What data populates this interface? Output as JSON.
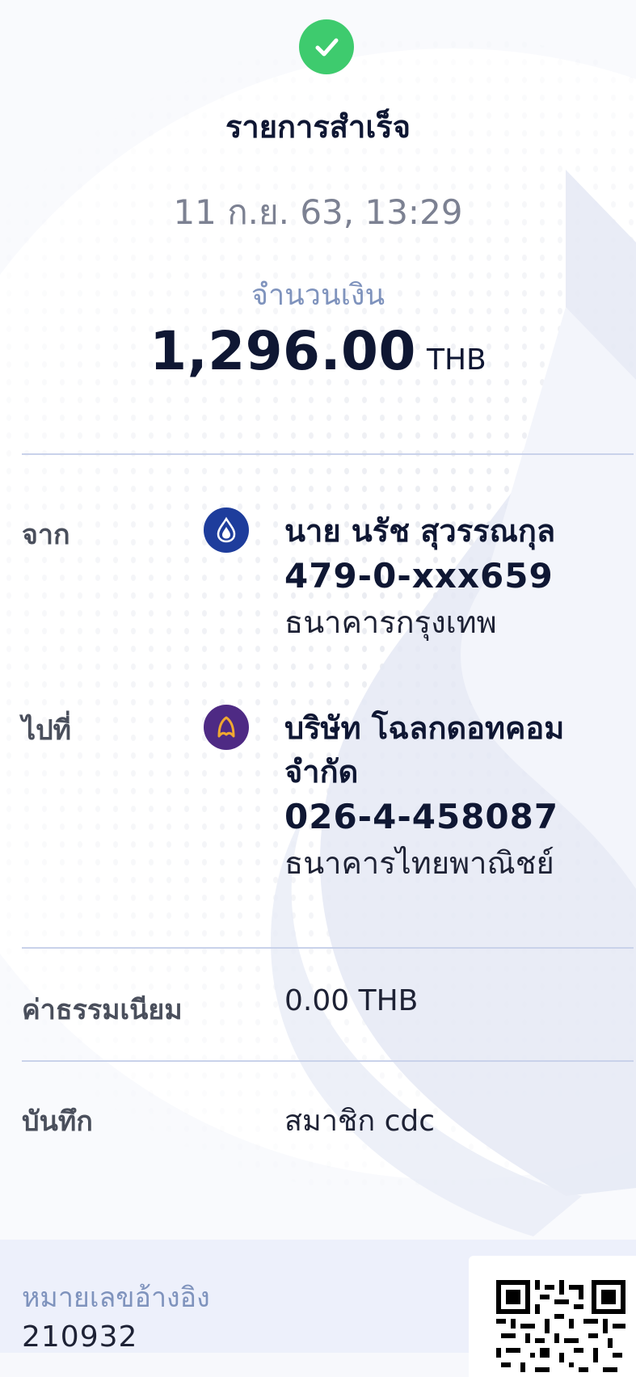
{
  "status": {
    "title": "รายการสำเร็จ",
    "icon": "check-circle-icon",
    "color": "#3ecb6e"
  },
  "datetime": "11 ก.ย. 63, 13:29",
  "amount": {
    "label": "จำนวนเงิน",
    "value": "1,296.00",
    "currency": "THB"
  },
  "from": {
    "label": "จาก",
    "name": "นาย นรัช สุวรรณกุล",
    "account": "479-0-xxx659",
    "bank": "ธนาคารกรุงเทพ",
    "logo": "bangkok-bank-logo-icon",
    "logo_color": "#1e3d9c"
  },
  "to": {
    "label": "ไปที่",
    "name_line1": "บริษัท โฉลกดอทคอม",
    "name_line2": "จำกัด",
    "account": "026-4-458087",
    "bank": "ธนาคารไทยพาณิชย์",
    "logo": "scb-logo-icon",
    "logo_color": "#4e2a84"
  },
  "fee": {
    "label": "ค่าธรรมเนียม",
    "value": "0.00 THB"
  },
  "memo": {
    "label": "บันทึก",
    "value": "สมาชิก cdc"
  },
  "reference": {
    "label": "หมายเลขอ้างอิง",
    "value": "210932"
  },
  "qr": {
    "icon": "qr-code-icon"
  }
}
